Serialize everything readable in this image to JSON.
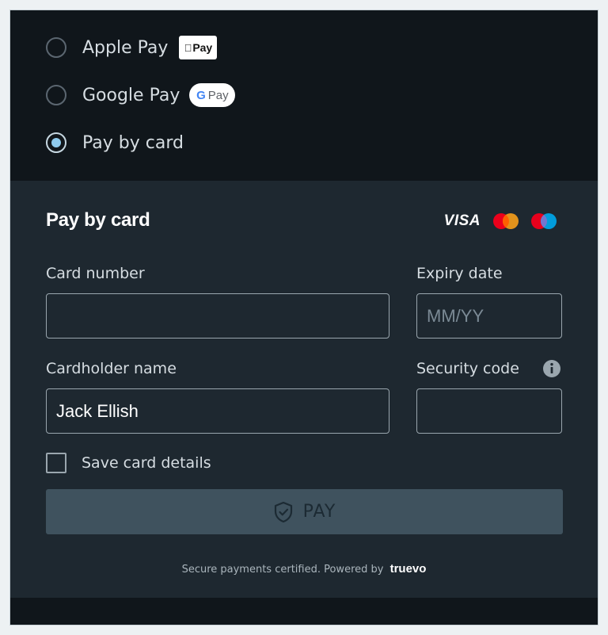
{
  "payment_methods": [
    {
      "label": "Apple Pay",
      "badge": "Pay",
      "selected": false
    },
    {
      "label": "Google Pay",
      "badge_g": "G",
      "badge": "Pay",
      "selected": false
    },
    {
      "label": "Pay by card",
      "selected": true
    }
  ],
  "card_panel": {
    "title": "Pay by card",
    "brands": {
      "visa": "VISA"
    },
    "fields": {
      "card_number": {
        "label": "Card number",
        "value": "",
        "placeholder": ""
      },
      "expiry": {
        "label": "Expiry date",
        "value": "",
        "placeholder": "MM/YY"
      },
      "cardholder": {
        "label": "Cardholder name",
        "value": "Jack Ellish",
        "placeholder": ""
      },
      "security_code": {
        "label": "Security code",
        "value": "",
        "placeholder": ""
      }
    },
    "save_card": {
      "label": "Save card details",
      "checked": false
    },
    "pay_button": {
      "label": "PAY"
    },
    "footer": {
      "text": "Secure payments certified. Powered by",
      "brand": "truevo"
    }
  },
  "colors": {
    "background": "#10161b",
    "panel": "#1e2830",
    "accent_radio": "#8fcbee",
    "pay_button": "#3f525e",
    "mastercard_red": "#eb001b",
    "mastercard_orange": "#f79e1b",
    "maestro_red": "#e7001c",
    "maestro_blue": "#00a2e5"
  },
  "icons": {
    "info": "info-icon",
    "shield": "shield-check-icon"
  }
}
